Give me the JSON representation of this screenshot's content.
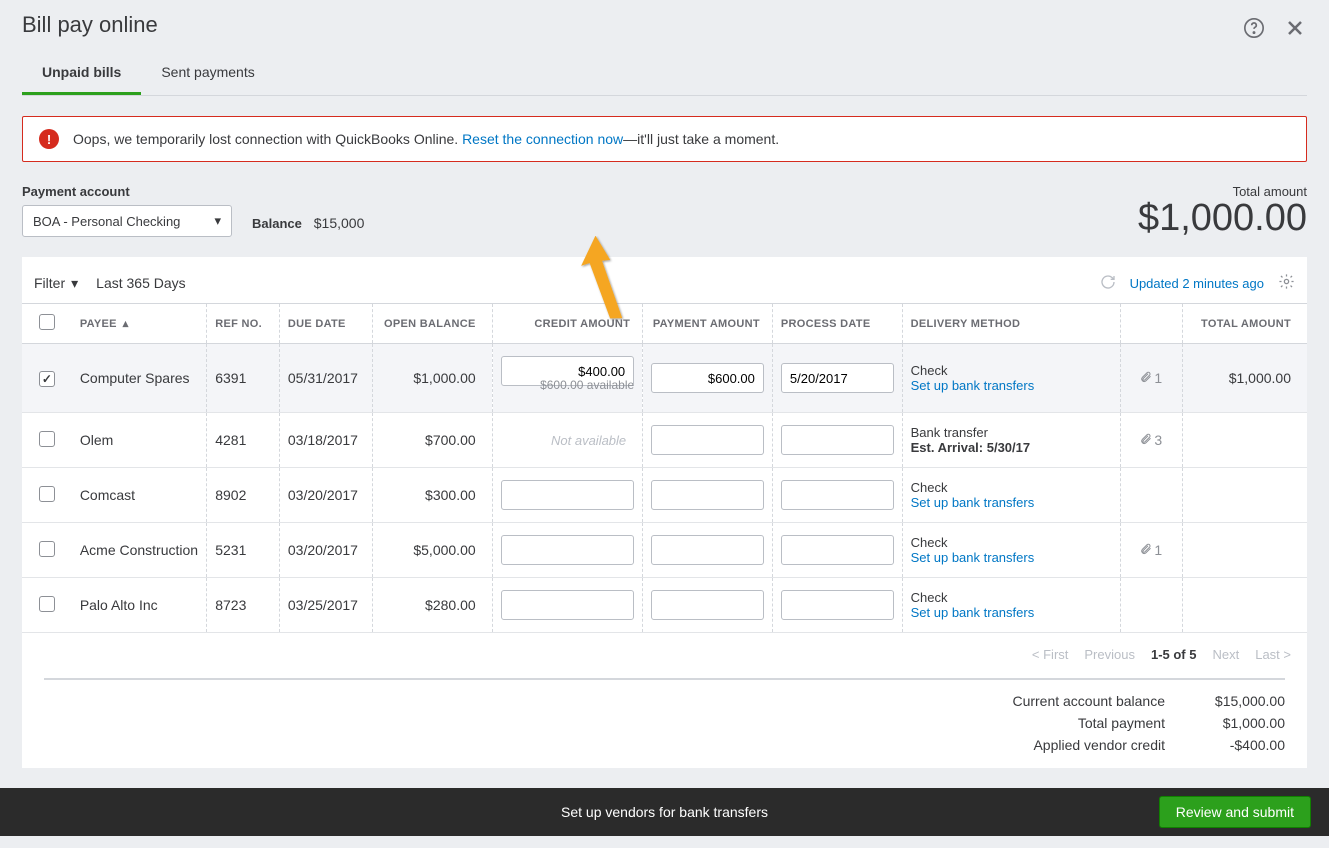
{
  "header": {
    "title": "Bill pay online"
  },
  "tabs": [
    {
      "label": "Unpaid bills",
      "active": true
    },
    {
      "label": "Sent payments",
      "active": false
    }
  ],
  "alert": {
    "text_before": "Oops, we temporarily lost connection with QuickBooks Online. ",
    "link": "Reset the connection now",
    "text_after": "—it'll just take a moment."
  },
  "payment_account": {
    "label": "Payment account",
    "selected": "BOA - Personal Checking",
    "balance_label": "Balance",
    "balance_value": "$15,000"
  },
  "total": {
    "label": "Total amount",
    "value": "$1,000.00"
  },
  "filter": {
    "label": "Filter",
    "range": "Last 365 Days",
    "updated": "Updated 2 minutes ago"
  },
  "columns": {
    "payee": "PAYEE",
    "ref": "REF NO.",
    "due": "DUE DATE",
    "open": "OPEN BALANCE",
    "credit": "CREDIT AMOUNT",
    "payment": "PAYMENT AMOUNT",
    "process": "PROCESS DATE",
    "delivery": "DELIVERY METHOD",
    "total": "TOTAL AMOUNT"
  },
  "rows": [
    {
      "checked": true,
      "payee": "Computer Spares",
      "ref": "6391",
      "due": "05/31/2017",
      "open": "$1,000.00",
      "credit": "$400.00",
      "credit_available": "$600.00 available",
      "payment": "$600.00",
      "process": "5/20/2017",
      "delivery_method": "Check",
      "delivery_link": "Set up bank transfers",
      "attachments": "1",
      "total": "$1,000.00"
    },
    {
      "checked": false,
      "payee": "Olem",
      "ref": "4281",
      "due": "03/18/2017",
      "open": "$700.00",
      "credit_na": "Not available",
      "delivery_method": "Bank transfer",
      "delivery_est": "Est. Arrival: 5/30/17",
      "attachments": "3"
    },
    {
      "checked": false,
      "payee": "Comcast",
      "ref": "8902",
      "due": "03/20/2017",
      "open": "$300.00",
      "delivery_method": "Check",
      "delivery_link": "Set up bank transfers"
    },
    {
      "checked": false,
      "payee": "Acme Construction",
      "ref": "5231",
      "due": "03/20/2017",
      "open": "$5,000.00",
      "delivery_method": "Check",
      "delivery_link": "Set up bank transfers",
      "attachments": "1"
    },
    {
      "checked": false,
      "payee": "Palo Alto Inc",
      "ref": "8723",
      "due": "03/25/2017",
      "open": "$280.00",
      "delivery_method": "Check",
      "delivery_link": "Set up bank transfers"
    }
  ],
  "pagination": {
    "first": "< First",
    "prev": "Previous",
    "range": "1-5 of 5",
    "next": "Next",
    "last": "Last >"
  },
  "summary": {
    "balance_label": "Current account balance",
    "balance_value": "$15,000.00",
    "payment_label": "Total payment",
    "payment_value": "$1,000.00",
    "credit_label": "Applied vendor credit",
    "credit_value": "-$400.00"
  },
  "footer": {
    "link": "Set up vendors for bank transfers",
    "submit": "Review and submit"
  }
}
